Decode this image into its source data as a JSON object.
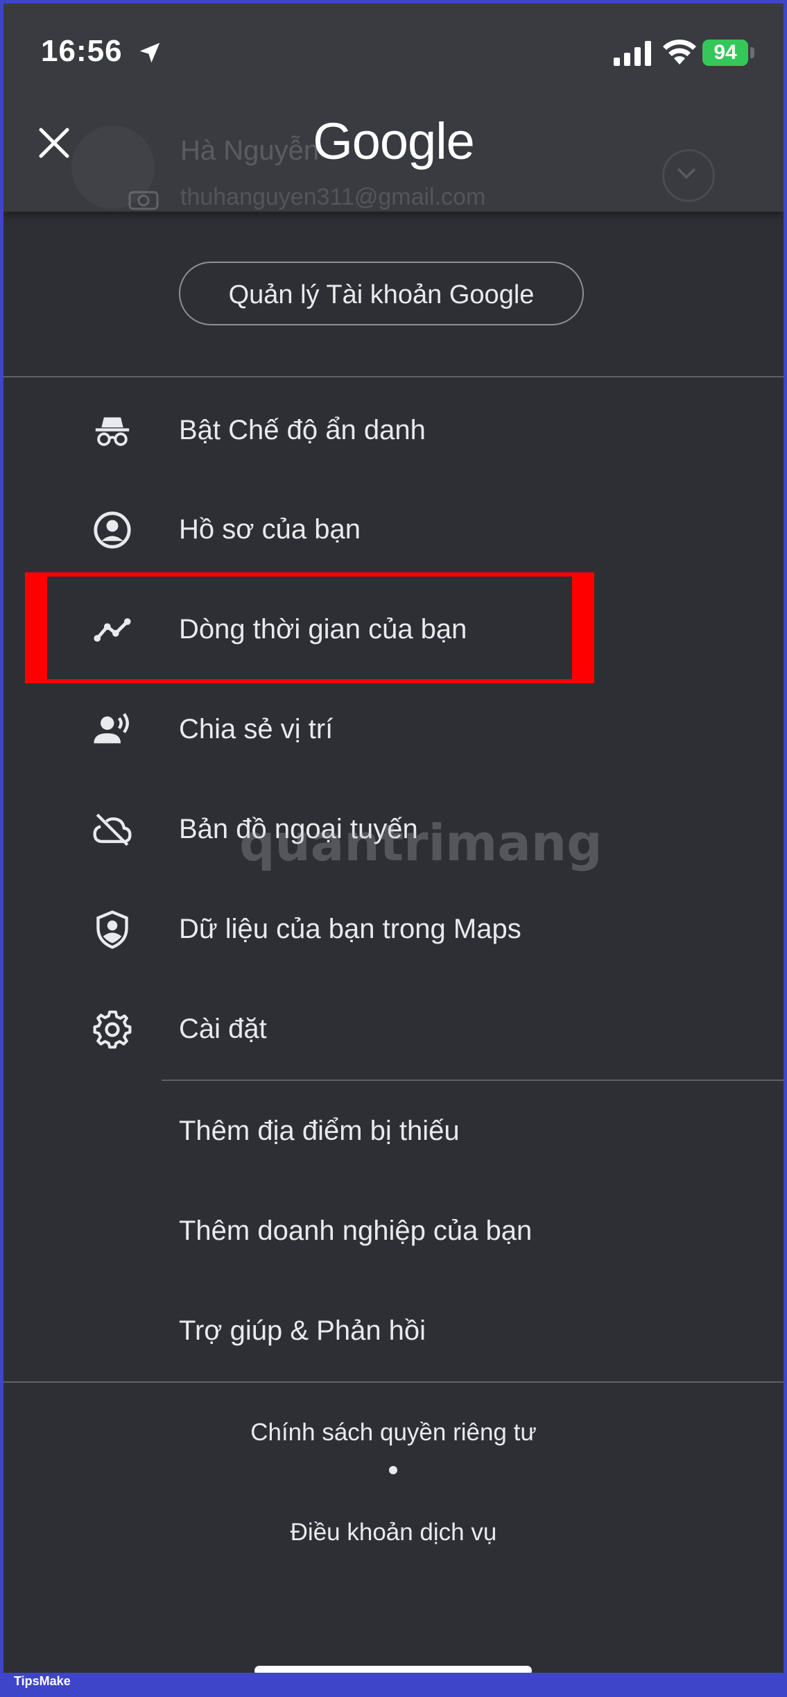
{
  "status_bar": {
    "time": "16:56",
    "battery": "94"
  },
  "header": {
    "logo_text": "Google",
    "account_name": "Hà Nguyễn",
    "account_email": "thuhanguyen311@gmail.com"
  },
  "manage_account_label": "Quản lý Tài khoản Google",
  "menu": {
    "items": [
      {
        "label": "Bật Chế độ ẩn danh",
        "icon": "incognito-icon"
      },
      {
        "label": "Hồ sơ của bạn",
        "icon": "account-circle-icon"
      },
      {
        "label": "Dòng thời gian của bạn",
        "icon": "timeline-icon"
      },
      {
        "label": "Chia sẻ vị trí",
        "icon": "location-sharing-icon"
      },
      {
        "label": "Bản đồ ngoại tuyến",
        "icon": "cloud-off-icon"
      },
      {
        "label": "Dữ liệu của bạn trong Maps",
        "icon": "shield-account-icon"
      },
      {
        "label": "Cài đặt",
        "icon": "gear-icon"
      }
    ],
    "secondary_items": [
      {
        "label": "Thêm địa điểm bị thiếu"
      },
      {
        "label": "Thêm doanh nghiệp của bạn"
      },
      {
        "label": "Trợ giúp & Phản hồi"
      }
    ]
  },
  "footer": {
    "privacy_label": "Chính sách quyền riêng tư",
    "terms_label": "Điều khoản dịch vụ"
  },
  "watermark_text": "quantrimang",
  "badge_text": "TipsMake",
  "colors": {
    "background": "#2e2f34",
    "header": "#3a3b40",
    "highlight": "#ff0000",
    "frame": "#3f45c8",
    "battery": "#35c759"
  }
}
